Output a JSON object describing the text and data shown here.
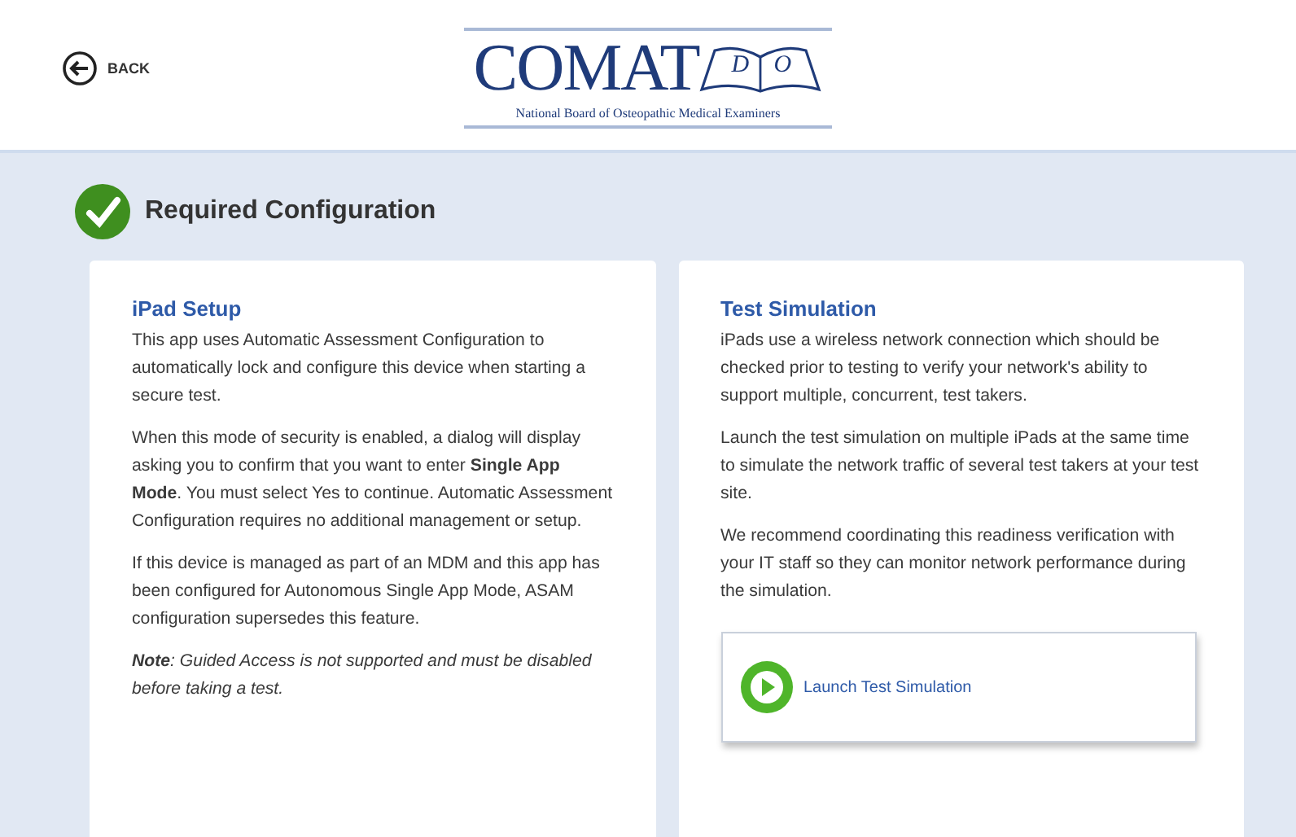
{
  "header": {
    "back": {
      "label": "BACK"
    },
    "logo": {
      "name": "COMAT",
      "book_letters": [
        "D",
        "O"
      ],
      "tagline": "National Board of Osteopathic Medical Examiners"
    }
  },
  "section": {
    "title": "Required Configuration",
    "complete": true
  },
  "cards": [
    {
      "title": "iPad Setup",
      "paragraphs": [
        {
          "kind": "text",
          "text": "This app uses Automatic Assessment Configuration to automatically lock and configure this device when starting a secure test."
        },
        {
          "kind": "text",
          "text": "When this mode of security is enabled, a dialog will display asking you to confirm that you want to enter **Single App Mode**. You must select Yes to continue. Automatic Assessment Configuration requires no additional management or setup."
        },
        {
          "kind": "text",
          "text": "If this device is managed as part of an MDM and this app has been configured for Autonomous Single App Mode, ASAM configuration supersedes this feature."
        },
        {
          "kind": "note",
          "text": "**Note**: Guided Access is not supported and must be disabled before taking a test."
        }
      ]
    },
    {
      "title": "Test Simulation",
      "paragraphs": [
        {
          "kind": "text",
          "text": "iPads use a wireless network connection which should be checked prior to testing to verify your network's ability to support multiple, concurrent, test takers."
        },
        {
          "kind": "text",
          "text": "Launch the test simulation on multiple iPads at the same time to simulate the network traffic of several test takers at your test site."
        },
        {
          "kind": "text",
          "text": "We recommend coordinating this readiness verification with your IT staff so they can monitor network performance during the simulation."
        }
      ],
      "button": {
        "label": "Launch Test Simulation"
      }
    }
  ]
}
